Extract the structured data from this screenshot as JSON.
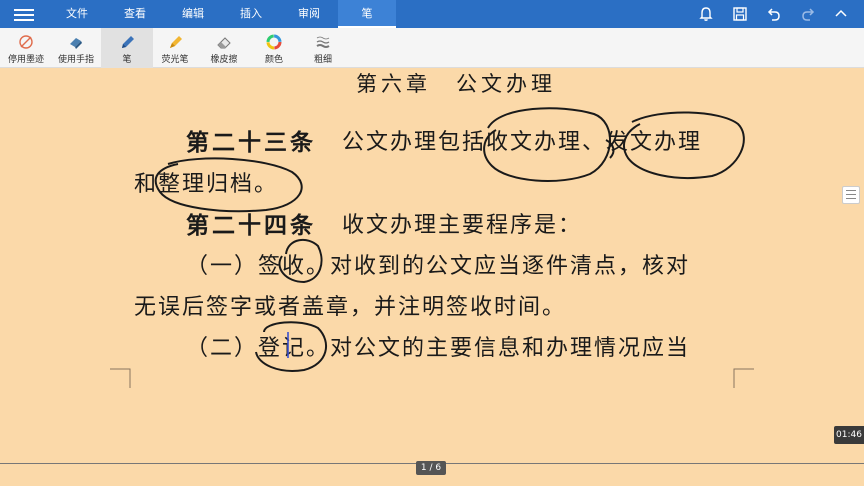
{
  "menu": {
    "tabs": [
      {
        "label": "文件"
      },
      {
        "label": "查看"
      },
      {
        "label": "编辑"
      },
      {
        "label": "插入"
      },
      {
        "label": "审阅"
      },
      {
        "label": "笔"
      }
    ],
    "active_tab": "笔"
  },
  "toolbar_icons": [
    "bell-icon",
    "save-icon",
    "undo-icon",
    "redo-icon",
    "expand-icon"
  ],
  "ribbon": {
    "items": [
      {
        "label": "停用墨迹",
        "icon": "ink-off-icon"
      },
      {
        "label": "使用手指",
        "icon": "finger-icon"
      },
      {
        "label": "笔",
        "icon": "pen-icon"
      },
      {
        "label": "荧光笔",
        "icon": "highlighter-icon"
      },
      {
        "label": "橡皮擦",
        "icon": "eraser-icon"
      },
      {
        "label": "颜色",
        "icon": "color-icon"
      },
      {
        "label": "粗细",
        "icon": "thickness-icon"
      }
    ],
    "active_item": "笔"
  },
  "document": {
    "chapter_title": "第六章　公文办理",
    "article23": {
      "title": "第二十三条",
      "text1": "公文办理包括收文办理、发文办理",
      "text2": "和整理归档。"
    },
    "article24": {
      "title": "第二十四条",
      "text": "收文办理主要程序是："
    },
    "item1": {
      "text1": "（一）签收。对收到的公文应当逐件清点，核对",
      "text2": "无误后签字或者盖章，并注明签收时间。"
    },
    "item2": {
      "text1": "（二）登记。对公文的主要信息和办理情况应当"
    }
  },
  "video_time": "01:46",
  "page_indicator": "1 / 6",
  "colors": {
    "menu_bar": "#2b6fc4",
    "paper": "#fbd9a9",
    "ink": "#1a1a1a"
  }
}
